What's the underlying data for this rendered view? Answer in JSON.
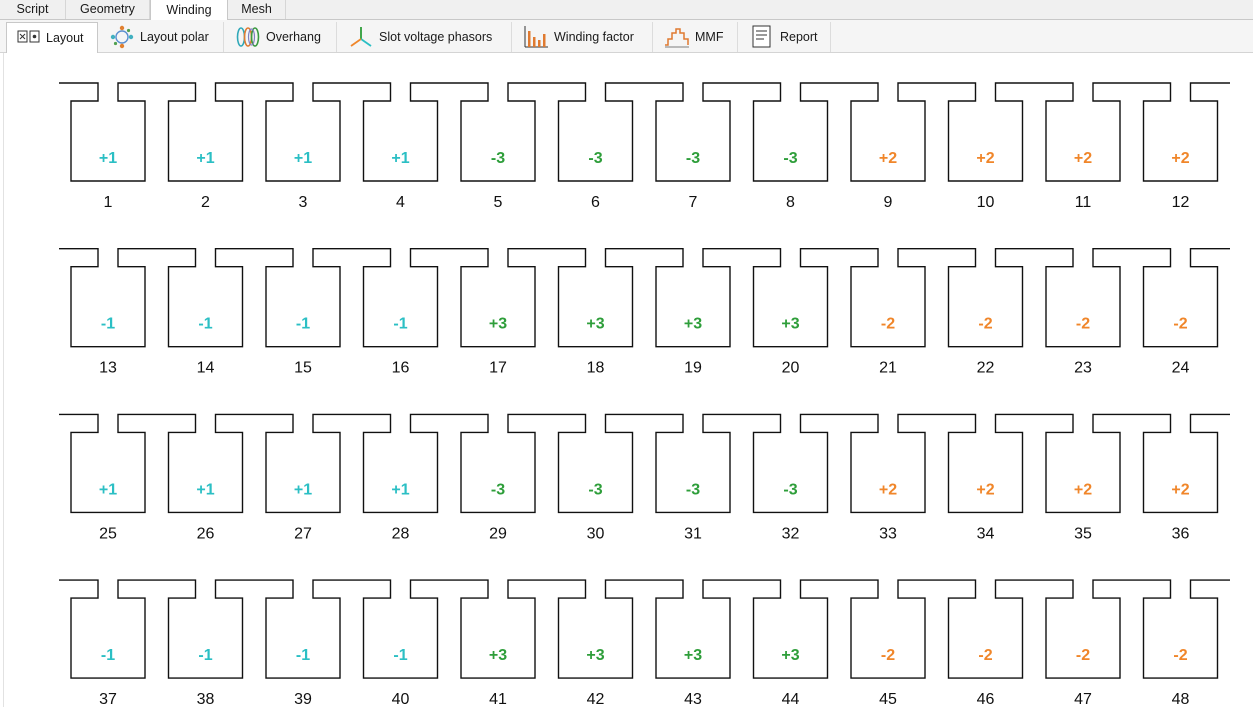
{
  "top_tabs": [
    {
      "label": "Script",
      "active": false
    },
    {
      "label": "Geometry",
      "active": false
    },
    {
      "label": "Winding",
      "active": true
    },
    {
      "label": "Mesh",
      "active": false
    }
  ],
  "sub_tabs": [
    {
      "label": "Layout",
      "icon": "layout-icon",
      "active": true
    },
    {
      "label": "Layout polar",
      "icon": "layout-polar-icon",
      "active": false
    },
    {
      "label": "Overhang",
      "icon": "overhang-icon",
      "active": false
    },
    {
      "label": "Slot voltage phasors",
      "icon": "phasor-icon",
      "active": false
    },
    {
      "label": "Winding factor",
      "icon": "bar-chart-icon",
      "active": false
    },
    {
      "label": "MMF",
      "icon": "mmf-step-icon",
      "active": false
    },
    {
      "label": "Report",
      "icon": "report-icon",
      "active": false
    }
  ],
  "phase_colors": {
    "1": "#2bbfc4",
    "2": "#f0862a",
    "3": "#2e9e3a"
  },
  "slots": [
    {
      "number": "1",
      "coil": "+1",
      "phase": "1"
    },
    {
      "number": "2",
      "coil": "+1",
      "phase": "1"
    },
    {
      "number": "3",
      "coil": "+1",
      "phase": "1"
    },
    {
      "number": "4",
      "coil": "+1",
      "phase": "1"
    },
    {
      "number": "5",
      "coil": "-3",
      "phase": "3"
    },
    {
      "number": "6",
      "coil": "-3",
      "phase": "3"
    },
    {
      "number": "7",
      "coil": "-3",
      "phase": "3"
    },
    {
      "number": "8",
      "coil": "-3",
      "phase": "3"
    },
    {
      "number": "9",
      "coil": "+2",
      "phase": "2"
    },
    {
      "number": "10",
      "coil": "+2",
      "phase": "2"
    },
    {
      "number": "11",
      "coil": "+2",
      "phase": "2"
    },
    {
      "number": "12",
      "coil": "+2",
      "phase": "2"
    },
    {
      "number": "13",
      "coil": "-1",
      "phase": "1"
    },
    {
      "number": "14",
      "coil": "-1",
      "phase": "1"
    },
    {
      "number": "15",
      "coil": "-1",
      "phase": "1"
    },
    {
      "number": "16",
      "coil": "-1",
      "phase": "1"
    },
    {
      "number": "17",
      "coil": "+3",
      "phase": "3"
    },
    {
      "number": "18",
      "coil": "+3",
      "phase": "3"
    },
    {
      "number": "19",
      "coil": "+3",
      "phase": "3"
    },
    {
      "number": "20",
      "coil": "+3",
      "phase": "3"
    },
    {
      "number": "21",
      "coil": "-2",
      "phase": "2"
    },
    {
      "number": "22",
      "coil": "-2",
      "phase": "2"
    },
    {
      "number": "23",
      "coil": "-2",
      "phase": "2"
    },
    {
      "number": "24",
      "coil": "-2",
      "phase": "2"
    },
    {
      "number": "25",
      "coil": "+1",
      "phase": "1"
    },
    {
      "number": "26",
      "coil": "+1",
      "phase": "1"
    },
    {
      "number": "27",
      "coil": "+1",
      "phase": "1"
    },
    {
      "number": "28",
      "coil": "+1",
      "phase": "1"
    },
    {
      "number": "29",
      "coil": "-3",
      "phase": "3"
    },
    {
      "number": "30",
      "coil": "-3",
      "phase": "3"
    },
    {
      "number": "31",
      "coil": "-3",
      "phase": "3"
    },
    {
      "number": "32",
      "coil": "-3",
      "phase": "3"
    },
    {
      "number": "33",
      "coil": "+2",
      "phase": "2"
    },
    {
      "number": "34",
      "coil": "+2",
      "phase": "2"
    },
    {
      "number": "35",
      "coil": "+2",
      "phase": "2"
    },
    {
      "number": "36",
      "coil": "+2",
      "phase": "2"
    },
    {
      "number": "37",
      "coil": "-1",
      "phase": "1"
    },
    {
      "number": "38",
      "coil": "-1",
      "phase": "1"
    },
    {
      "number": "39",
      "coil": "-1",
      "phase": "1"
    },
    {
      "number": "40",
      "coil": "-1",
      "phase": "1"
    },
    {
      "number": "41",
      "coil": "+3",
      "phase": "3"
    },
    {
      "number": "42",
      "coil": "+3",
      "phase": "3"
    },
    {
      "number": "43",
      "coil": "+3",
      "phase": "3"
    },
    {
      "number": "44",
      "coil": "+3",
      "phase": "3"
    },
    {
      "number": "45",
      "coil": "-2",
      "phase": "2"
    },
    {
      "number": "46",
      "coil": "-2",
      "phase": "2"
    },
    {
      "number": "47",
      "coil": "-2",
      "phase": "2"
    },
    {
      "number": "48",
      "coil": "-2",
      "phase": "2"
    }
  ]
}
